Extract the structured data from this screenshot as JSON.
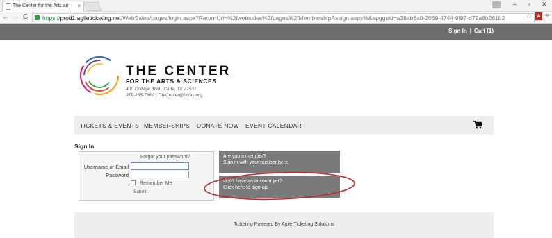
{
  "browser": {
    "tab_title": "The Center for the Arts an",
    "url_scheme": "https://",
    "url_host": "prod1.agileticketing.net",
    "url_rest": "/WebSales/pages/login.aspx?ReturnUrl=%2fwebsales%2fpages%2fMembershipAssign.aspx%&epgguid=a38ab6a0-2069-4744-9f97-d79a8b261b2"
  },
  "topbar": {
    "sign_in": "Sign In",
    "separator": "|",
    "cart": "Cart (1)"
  },
  "brand": {
    "title": "THE CENTER",
    "subtitle": "FOR THE ARTS & SCIENCES",
    "address_line1": "400 College Blvd., Clute, TX 77531",
    "address_line2": "979-265-7661 | TheCenter@bcfas.org"
  },
  "nav": {
    "items": [
      {
        "label": "TICKETS & EVENTS"
      },
      {
        "label": "MEMBERSHIPS"
      },
      {
        "label": "DONATE NOW"
      },
      {
        "label": "EVENT CALENDAR"
      }
    ]
  },
  "signin": {
    "heading": "Sign In",
    "forgot": "Forgot your password?",
    "username_label": "Username or Email",
    "password_label": "Password",
    "username_value": "",
    "password_value": "",
    "remember_label": "Remember Me",
    "submit_label": "Submit"
  },
  "promos": {
    "member_line1": "Are you a member?",
    "member_line2": "Sign in with your number here.",
    "signup_line1": "Don't have an account yet?",
    "signup_line2": "Click here to sign-up."
  },
  "footer": {
    "text": "Ticketing Powered By Agile Ticketing Solutions"
  },
  "colors": {
    "topbar": "#6d6d6d",
    "promo": "#7a7a7a",
    "highlight_ellipse": "#c0282b",
    "nav_bg": "#eeeeee"
  }
}
